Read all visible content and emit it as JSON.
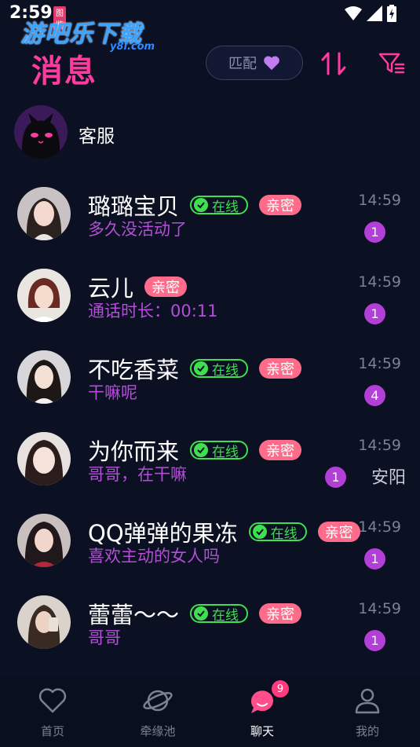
{
  "status": {
    "time": "2:59"
  },
  "watermark": {
    "badge": "图鉴",
    "title": "游吧乐下载",
    "url": "y8l.com"
  },
  "header": {
    "title": "消息",
    "match_label": "匹配"
  },
  "service": {
    "name": "客服"
  },
  "colors": {
    "accent": "#ff3b9d",
    "online": "#3ee04f",
    "intimate": "#ff6b8a",
    "message": "#b34fd6",
    "unread": "#b23fd6",
    "background": "#0b1022"
  },
  "conversations": [
    {
      "name": "璐璐宝贝",
      "online": "在线",
      "intimate": "亲密",
      "message": "多久没活动了",
      "time": "14:59",
      "unread": "1"
    },
    {
      "name": "云儿",
      "intimate": "亲密",
      "message": "通话时长：00:11",
      "time": "14:59",
      "unread": "1"
    },
    {
      "name": "不吃香菜",
      "online": "在线",
      "intimate": "亲密",
      "message": "干嘛呢",
      "time": "14:59",
      "unread": "4"
    },
    {
      "name": "为你而来",
      "online": "在线",
      "intimate": "亲密",
      "message": "哥哥，在干嘛",
      "time": "14:59",
      "unread": "1",
      "location": "安阳"
    },
    {
      "name": "QQ弹弹的果冻",
      "online": "在线",
      "intimate": "亲密",
      "message": "喜欢主动的女人吗",
      "time": "14:59",
      "unread": "1"
    },
    {
      "name": "蕾蕾～～",
      "online": "在线",
      "intimate": "亲密",
      "message": "哥哥",
      "time": "14:59",
      "unread": "1"
    }
  ],
  "tabs": [
    {
      "label": "首页",
      "icon": "heart-outline-icon"
    },
    {
      "label": "牵缘池",
      "icon": "planet-icon"
    },
    {
      "label": "聊天",
      "icon": "chat-bubble-icon",
      "badge": "9"
    },
    {
      "label": "我的",
      "icon": "person-icon"
    }
  ]
}
